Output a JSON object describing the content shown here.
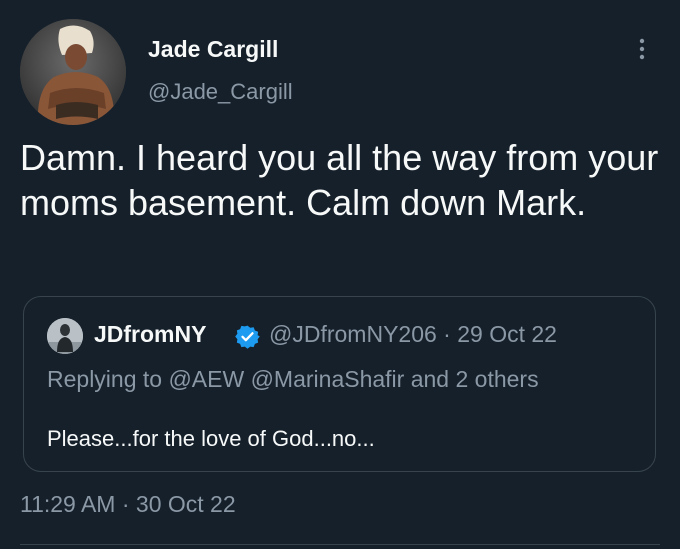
{
  "tweet": {
    "author_name": "Jade Cargill",
    "author_handle": "@Jade_Cargill",
    "text": "Damn. I heard you all the way from your moms basement. Calm down Mark.",
    "timestamp": "11:29 AM · 30 Oct 22"
  },
  "quoted_tweet": {
    "author_name": "JDfromNY",
    "meta": "@JDfromNY206 · 29 Oct 22",
    "replying_to": "Replying to @AEW @MarinaShafir and 2 others",
    "text": "Please...for the love of God...no..."
  },
  "icons": {
    "more": "more-vertical-icon",
    "verified": "verified-badge-icon"
  },
  "colors": {
    "background": "#15202b",
    "primary_text": "#f7f9f9",
    "secondary_text": "#8b98a5",
    "border": "#38444d",
    "verified_blue": "#1d9bf0"
  }
}
